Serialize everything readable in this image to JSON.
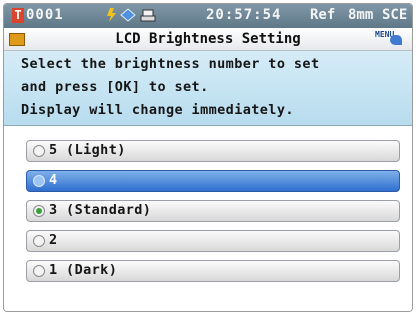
{
  "status_bar": {
    "id": "0001",
    "icons": [
      "power-icon",
      "lens-icon",
      "printer-icon"
    ],
    "time": "20:57:54",
    "ref": "Ref",
    "aperture": "8mm",
    "mode": "SCE"
  },
  "title_bar": {
    "title": "LCD Brightness Setting",
    "menu_label": "MENU"
  },
  "instructions": {
    "line1": "Select the brightness number to set",
    "line2": "and press [OK] to set.",
    "line3": "Display will change immediately."
  },
  "options": [
    {
      "label": "5 (Light)",
      "selected": false,
      "highlighted": false
    },
    {
      "label": "4",
      "selected": false,
      "highlighted": true
    },
    {
      "label": "3 (Standard)",
      "selected": true,
      "highlighted": false
    },
    {
      "label": "2",
      "selected": false,
      "highlighted": false
    },
    {
      "label": "1 (Dark)",
      "selected": false,
      "highlighted": false
    }
  ],
  "colors": {
    "highlight": "#2f6fcf",
    "selected_radio": "#3aa13a",
    "status_bar": "#6d8594",
    "instructions_bg": "#c4e3f2"
  }
}
